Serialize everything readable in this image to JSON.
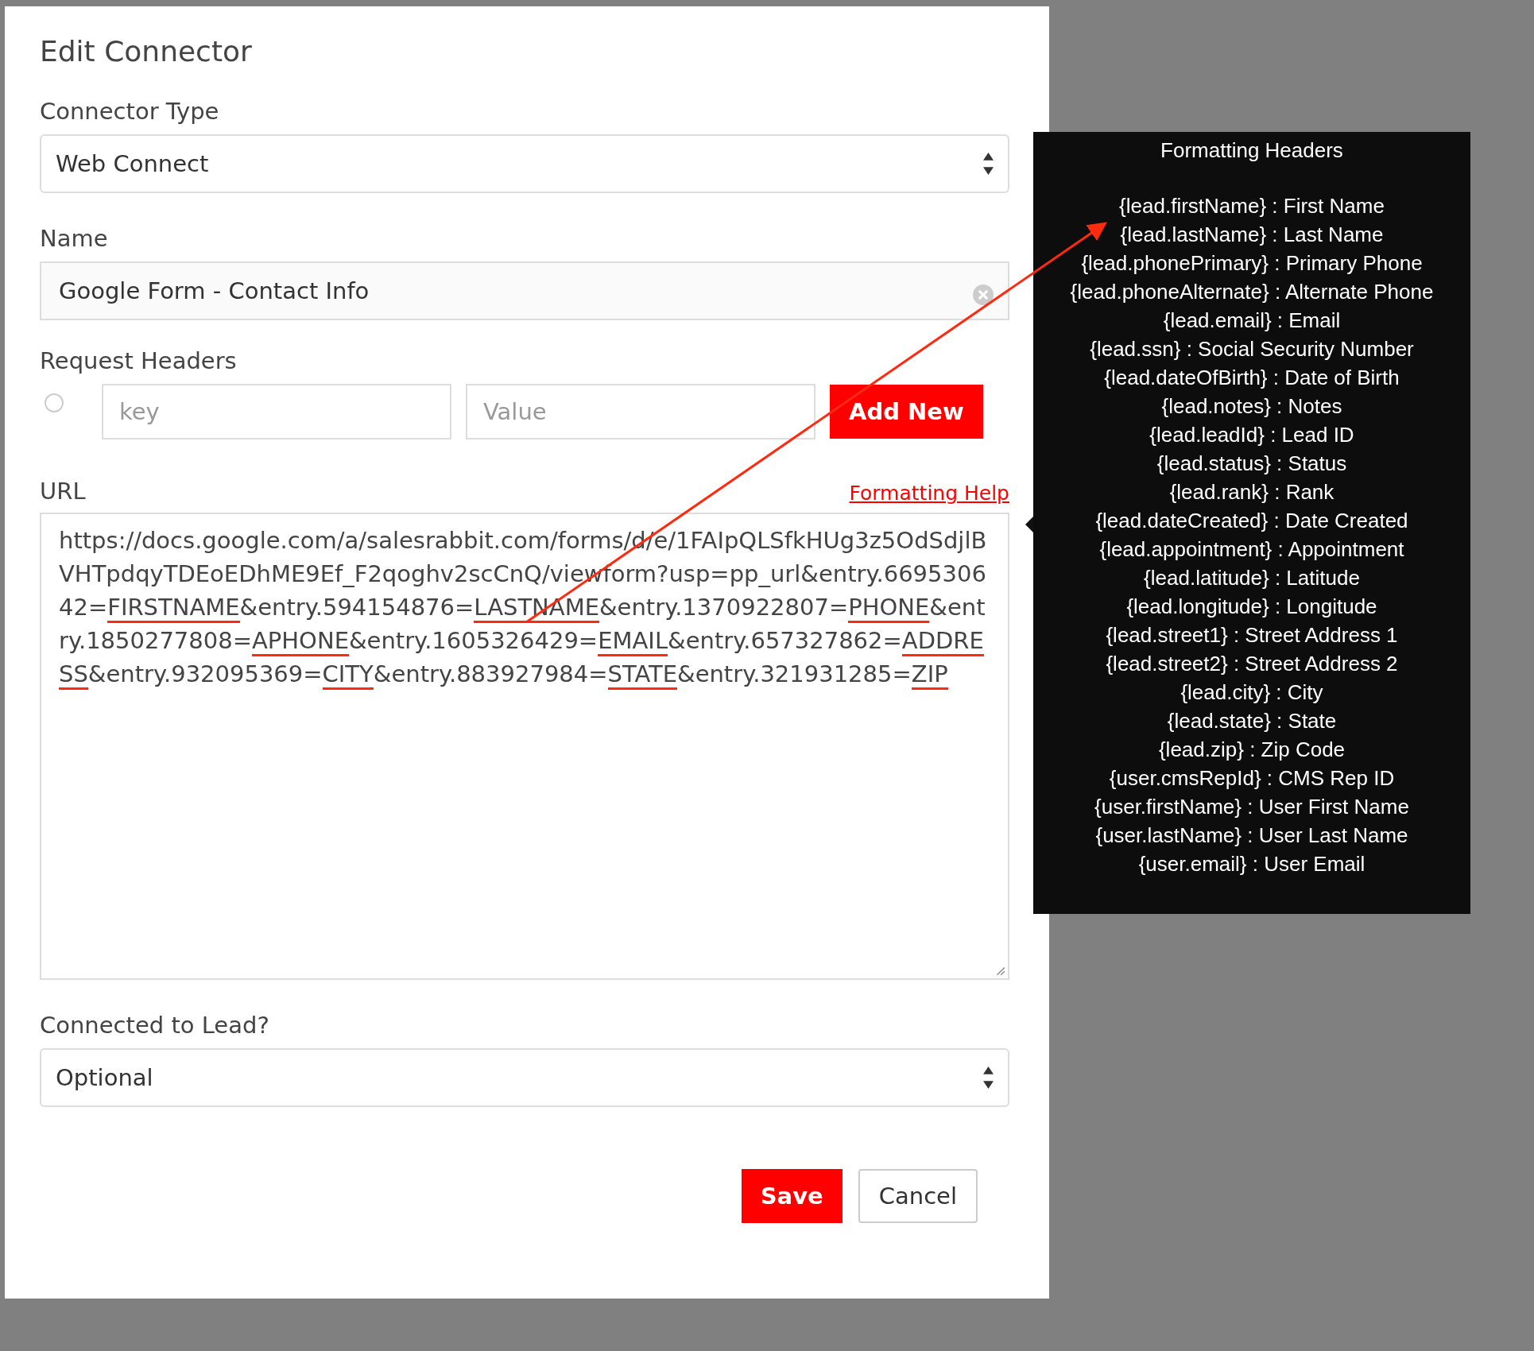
{
  "dialog": {
    "title": "Edit Connector",
    "connector_type": {
      "label": "Connector Type",
      "value": "Web Connect"
    },
    "name": {
      "label": "Name",
      "value": "Google Form - Contact Info"
    },
    "request_headers": {
      "label": "Request Headers",
      "selected": false,
      "key_placeholder": "key",
      "value_placeholder": "Value",
      "add_button": "Add New"
    },
    "url": {
      "label": "URL",
      "help_link": "Formatting Help",
      "segments": [
        {
          "text": "https://docs.google.com/a/salesrabbit.com/forms/d/e/1FAIpQLSfkHUg3z5OdSdjlBVHTpdqyTDEoEDhME9Ef_F2qoghv2scCnQ/viewform?usp=pp_url&entry.669530642=",
          "marked": false
        },
        {
          "text": "FIRSTNAME",
          "marked": true
        },
        {
          "text": "&entry.594154876=",
          "marked": false
        },
        {
          "text": "LASTNAME",
          "marked": true
        },
        {
          "text": "&entry.1370922807=",
          "marked": false
        },
        {
          "text": "PHONE",
          "marked": true
        },
        {
          "text": "&entry.1850277808=",
          "marked": false
        },
        {
          "text": "APHONE",
          "marked": true
        },
        {
          "text": "&entry.1605326429=",
          "marked": false
        },
        {
          "text": "EMAIL",
          "marked": true
        },
        {
          "text": "&entry.657327862=",
          "marked": false
        },
        {
          "text": "ADDRESS",
          "marked": true
        },
        {
          "text": "&entry.932095369=",
          "marked": false
        },
        {
          "text": "CITY",
          "marked": true
        },
        {
          "text": "&entry.883927984=",
          "marked": false
        },
        {
          "text": "STATE",
          "marked": true
        },
        {
          "text": "&entry.321931285=",
          "marked": false
        },
        {
          "text": "ZIP",
          "marked": true
        }
      ]
    },
    "connected_to_lead": {
      "label": "Connected to Lead?",
      "value": "Optional"
    },
    "buttons": [
      {
        "label": "Save",
        "kind": "primary"
      },
      {
        "label": "Cancel",
        "kind": "secondary"
      }
    ]
  },
  "tooltip": {
    "title": "Formatting Headers",
    "lines": [
      "{lead.firstName} : First Name",
      "{lead.lastName} : Last Name",
      "{lead.phonePrimary} : Primary Phone",
      "{lead.phoneAlternate} : Alternate Phone",
      "{lead.email} : Email",
      "{lead.ssn} : Social Security Number",
      "{lead.dateOfBirth} : Date of Birth",
      "{lead.notes} : Notes",
      "{lead.leadId} : Lead ID",
      "{lead.status} : Status",
      "{lead.rank} : Rank",
      "{lead.dateCreated} : Date Created",
      "{lead.appointment} : Appointment",
      "{lead.latitude} : Latitude",
      "{lead.longitude} : Longitude",
      "{lead.street1} : Street Address 1",
      "{lead.street2} : Street Address 2",
      "{lead.city} : City",
      "{lead.state} : State",
      "{lead.zip} : Zip Code",
      "{user.cmsRepId} : CMS Rep ID",
      "{user.firstName} : User First Name",
      "{user.lastName} : User Last Name",
      "{user.email} : User Email"
    ]
  }
}
